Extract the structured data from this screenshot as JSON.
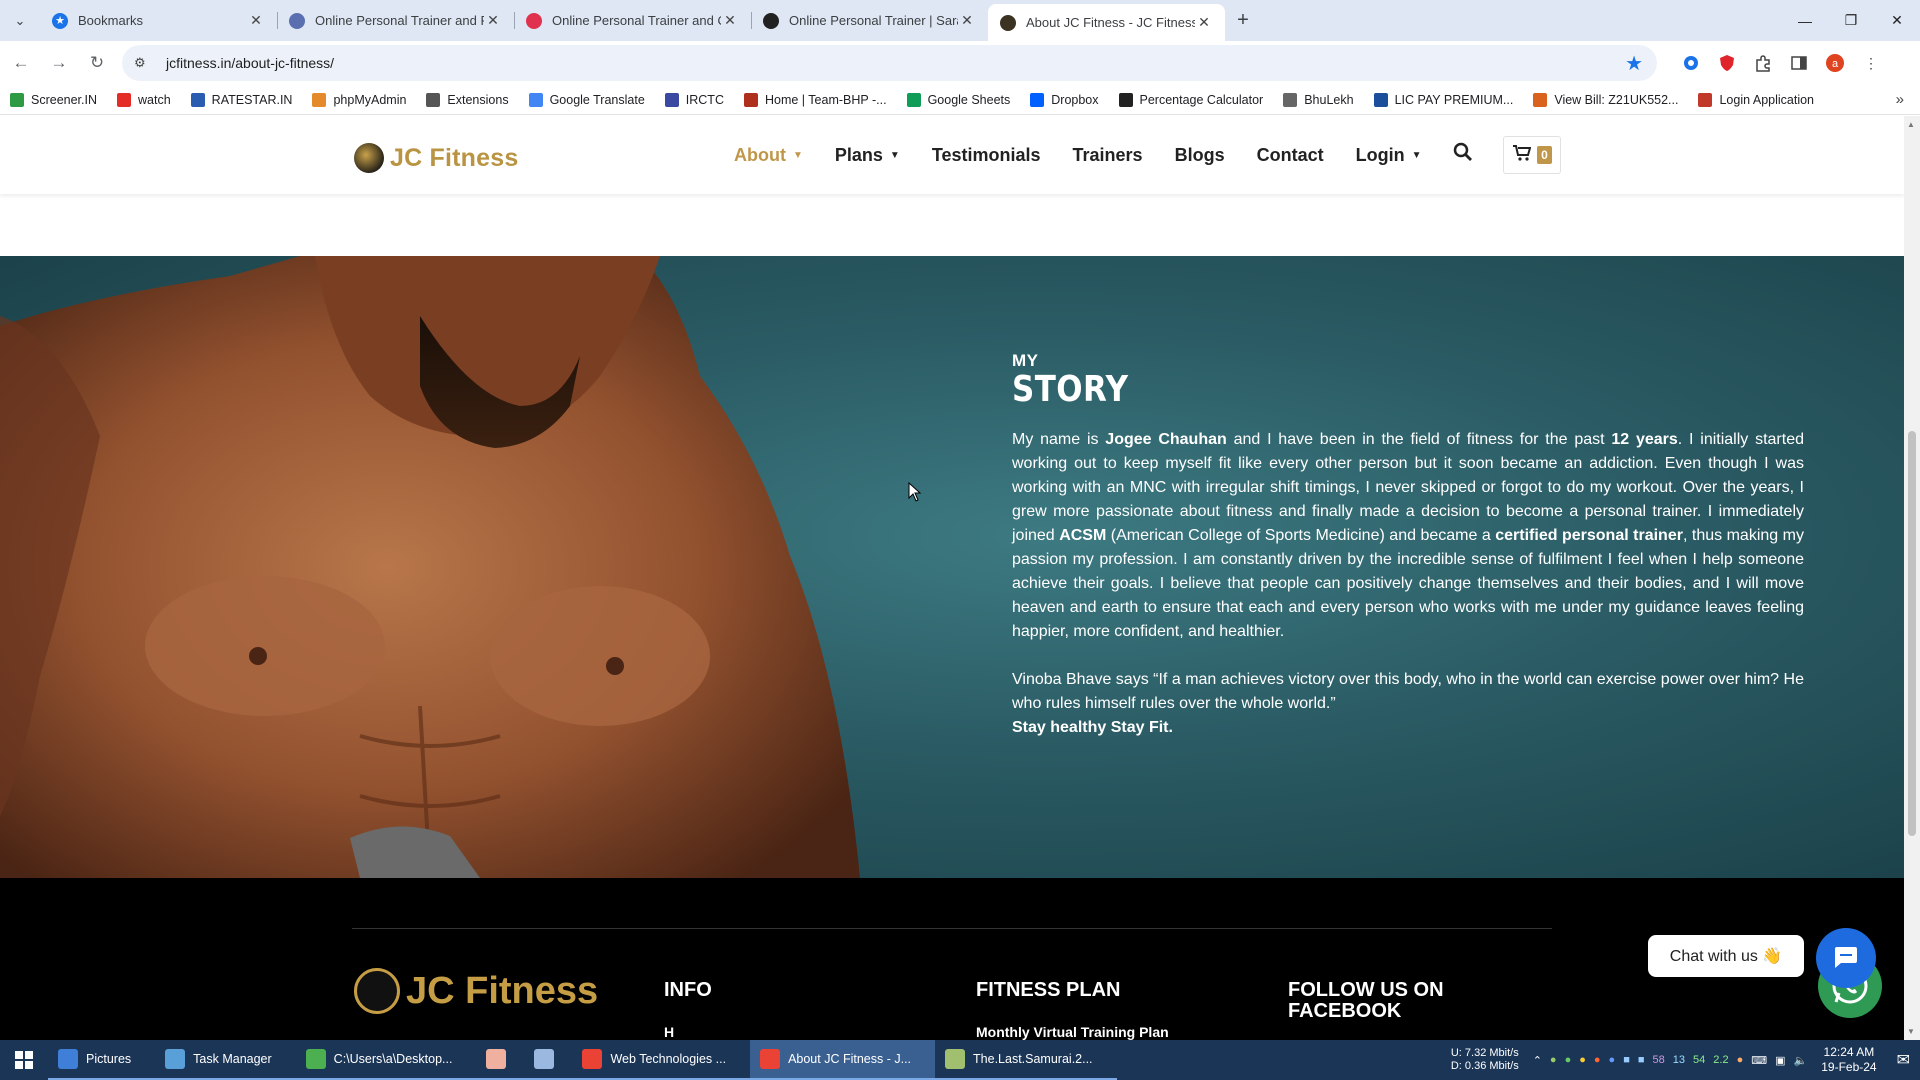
{
  "browser": {
    "tabs": [
      {
        "title": "Bookmarks",
        "icon": "star-icon",
        "color": "#1a73e8",
        "active": false
      },
      {
        "title": "Online Personal Trainer and Fitn",
        "icon": "site-icon",
        "color": "#5a6fb0",
        "active": false
      },
      {
        "title": "Online Personal Trainer and Onl",
        "icon": "site-icon",
        "color": "#e0324f",
        "active": false
      },
      {
        "title": "Online Personal Trainer | Sarah",
        "icon": "site-icon",
        "color": "#222222",
        "active": false
      },
      {
        "title": "About JC Fitness - JC Fitness",
        "icon": "site-icon",
        "color": "#3b3222",
        "active": true
      }
    ],
    "url": "jcfitness.in/about-jc-fitness/",
    "bookmarks": [
      {
        "label": "Screener.IN",
        "color": "#2e9b44"
      },
      {
        "label": "watch",
        "color": "#e52d27"
      },
      {
        "label": "RATESTAR.IN",
        "color": "#2a5db0"
      },
      {
        "label": "phpMyAdmin",
        "color": "#e58a2a"
      },
      {
        "label": "Extensions",
        "color": "#555555"
      },
      {
        "label": "Google Translate",
        "color": "#4285f4"
      },
      {
        "label": "IRCTC",
        "color": "#3b4aa0"
      },
      {
        "label": "Home | Team-BHP -...",
        "color": "#b0301e"
      },
      {
        "label": "Google Sheets",
        "color": "#0f9d58"
      },
      {
        "label": "Dropbox",
        "color": "#0061ff"
      },
      {
        "label": "Percentage Calculator",
        "color": "#222222"
      },
      {
        "label": "BhuLekh",
        "color": "#666666"
      },
      {
        "label": "LIC PAY PREMIUM...",
        "color": "#1c4e9b"
      },
      {
        "label": "View Bill: Z21UK552...",
        "color": "#d9631c"
      },
      {
        "label": "Login Application",
        "color": "#c0392b"
      }
    ]
  },
  "site": {
    "logo_text": "JC Fitness",
    "accent": "#c0974a",
    "menu": [
      {
        "label": "About",
        "caret": true,
        "active": true
      },
      {
        "label": "Plans",
        "caret": true,
        "active": false
      },
      {
        "label": "Testimonials",
        "caret": false,
        "active": false
      },
      {
        "label": "Trainers",
        "caret": false,
        "active": false
      },
      {
        "label": "Blogs",
        "caret": false,
        "active": false
      },
      {
        "label": "Contact",
        "caret": false,
        "active": false
      },
      {
        "label": "Login",
        "caret": true,
        "active": false
      }
    ],
    "cart_count": "0"
  },
  "story": {
    "kicker": "MY",
    "title": "STORY",
    "p1_a": "My name is ",
    "p1_name": "Jogee Chauhan",
    "p1_b": " and I have been in the field of fitness for the past ",
    "p1_years": "12 years",
    "p1_c": ". I initially started working out to keep myself fit like every other person but it soon became an addiction. Even though I was working with an MNC with irregular shift timings, I never skipped or forgot to do my workout. Over the years, I grew more passionate about fitness and finally made a decision to become a personal trainer. I immediately joined ",
    "p1_acsm": "ACSM",
    "p1_d": " (American College of Sports Medicine) and became a ",
    "p1_cert": "certified personal trainer",
    "p1_e": ", thus making my passion my profession. I am constantly driven by the incredible sense of fulfilment I feel when I help someone achieve their goals. I believe that people can positively change themselves and their bodies, and I will move heaven and earth to ensure that each and every person who works with me under my guidance leaves feeling happier, more confident, and healthier.",
    "quote": "Vinoba Bhave says “If a man achieves victory over this body, who in the world can exercise power over him? He who rules himself  rules over the whole world.”",
    "tagline": "Stay healthy Stay Fit."
  },
  "footer": {
    "logo_text": "JC Fitness",
    "info_heading": "INFO",
    "info_first": "H",
    "plan_heading": "FITNESS PLAN",
    "plan_first": "Monthly Virtual Training Plan",
    "follow_heading_1": "FOLLOW US ON",
    "follow_heading_2": "FACEBOOK"
  },
  "chat": {
    "label": "Chat with us 👋"
  },
  "taskbar": {
    "items": [
      {
        "label": "Pictures",
        "color": "#3f7fd8"
      },
      {
        "label": "Task Manager",
        "color": "#5aa0d8"
      },
      {
        "label": "C:\\Users\\a\\Desktop...",
        "color": "#4caf50"
      },
      {
        "label": "",
        "color": "#f0b0a0"
      },
      {
        "label": "",
        "color": "#9ab8e0"
      },
      {
        "label": "Web Technologies ...",
        "color": "#ea4335"
      },
      {
        "label": "About JC Fitness - J...",
        "color": "#ea4335"
      },
      {
        "label": "The.Last.Samurai.2...",
        "color": "#a0c070"
      }
    ],
    "net_up": "U:    7.32 Mbit/s",
    "net_down": "D:    0.36 Mbit/s",
    "tray_nums": [
      "58",
      "13",
      "54",
      "2.2"
    ],
    "time": "12:24 AM",
    "date": "19-Feb-24"
  }
}
